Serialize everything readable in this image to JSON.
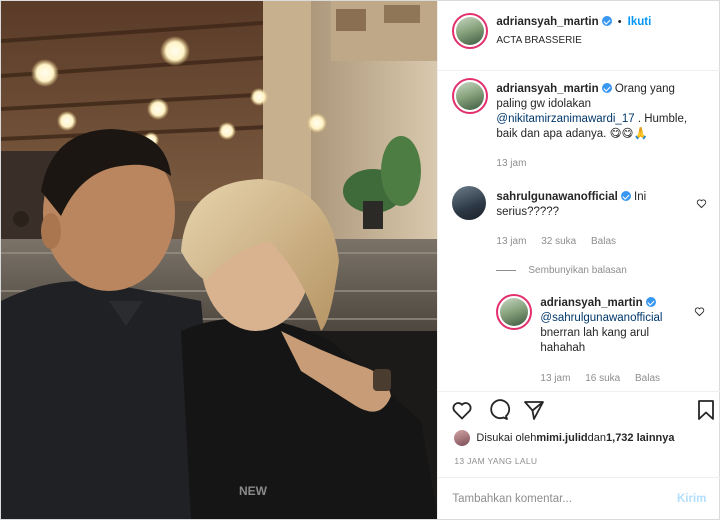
{
  "post": {
    "username": "adriansyah_martin",
    "follow_label": "Ikuti",
    "location": "ACTA BRASSERIE",
    "shirt_text": "NEW"
  },
  "caption": {
    "username": "adriansyah_martin",
    "text_before": "Orang yang paling gw idolakan ",
    "mention": "@nikitamirzanimawardi_17",
    "text_after": " . Humble, baik dan apa adanya. 😋😋🙏",
    "time": "13 jam"
  },
  "comments": [
    {
      "username": "sahrulgunawanofficial",
      "text": "Ini serius?????",
      "time": "13 jam",
      "likes": "32 suka",
      "reply_label": "Balas"
    }
  ],
  "hide_replies_label": "Sembunyikan balasan",
  "replies": [
    {
      "username": "adriansyah_martin",
      "mention": "@sahrulgunawanofficial",
      "text": "bnerran lah kang arul hahahah",
      "time": "13 jam",
      "likes": "16 suka",
      "reply_label": "Balas"
    }
  ],
  "likes": {
    "prefix": "Disukai oleh ",
    "first_user": "mimi.julid",
    "middle": " dan ",
    "count": "1,732 lainnya"
  },
  "timestamp": "13 JAM YANG LALU",
  "add_comment": {
    "placeholder": "Tambahkan komentar...",
    "post_label": "Kirim"
  },
  "colors": {
    "accent": "#0095f6",
    "verified": "#3897f0",
    "muted": "#8e8e8e",
    "story_ring": "#e1306c"
  },
  "icons": [
    "heart-icon",
    "comment-icon",
    "share-icon",
    "bookmark-icon",
    "verified-icon"
  ]
}
